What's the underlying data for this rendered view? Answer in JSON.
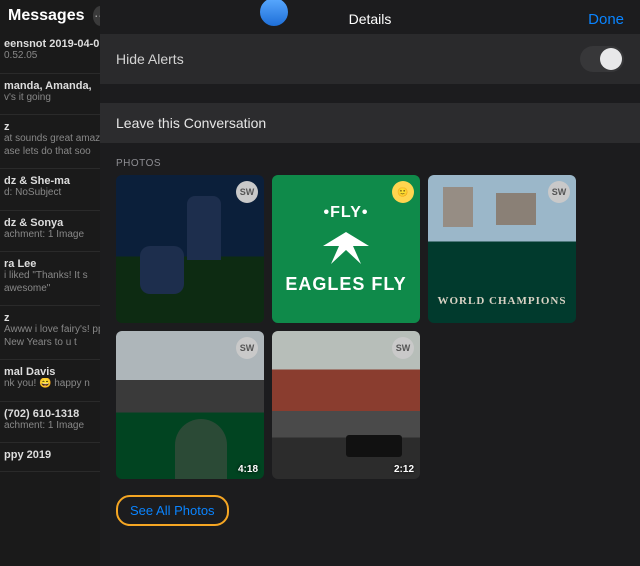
{
  "sidebar": {
    "title": "Messages",
    "conversations": [
      {
        "name": "eensnot 2019-04-0",
        "preview": "0.52.05"
      },
      {
        "name": "manda, Amanda,",
        "preview": "v's it going"
      },
      {
        "name": "z",
        "preview": "at sounds great amaz ase lets do that soo"
      },
      {
        "name": "dz & She-ma",
        "preview": "d: NoSubject"
      },
      {
        "name": "dz & Sonya",
        "preview": "achment: 1 Image"
      },
      {
        "name": "ra Lee",
        "preview": "i liked \"Thanks! It s awesome\""
      },
      {
        "name": "z",
        "preview": "Awww i love fairy's! ppy New Years to u t"
      },
      {
        "name": "mal Davis",
        "preview": "nk you! 😄 happy n"
      },
      {
        "name": "(702) 610-1318",
        "preview": "achment: 1 Image"
      },
      {
        "name": "ppy 2019",
        "preview": ""
      }
    ]
  },
  "panel": {
    "title": "Details",
    "done": "Done",
    "hide_alerts": "Hide Alerts",
    "leave": "Leave this Conversation",
    "photos_label": "PHOTOS",
    "see_all": "See All Photos",
    "photos": [
      {
        "badge": "SW",
        "duration": "",
        "badge_style": ""
      },
      {
        "badge": "",
        "duration": "",
        "badge_style": "y",
        "fly": "•FLY•",
        "eag": "EAGLES FLY"
      },
      {
        "badge": "SW",
        "duration": "",
        "badge_style": "",
        "champ": "WORLD CHAMPIONS"
      },
      {
        "badge": "SW",
        "duration": "4:18",
        "badge_style": ""
      },
      {
        "badge": "SW",
        "duration": "2:12",
        "badge_style": ""
      }
    ]
  }
}
